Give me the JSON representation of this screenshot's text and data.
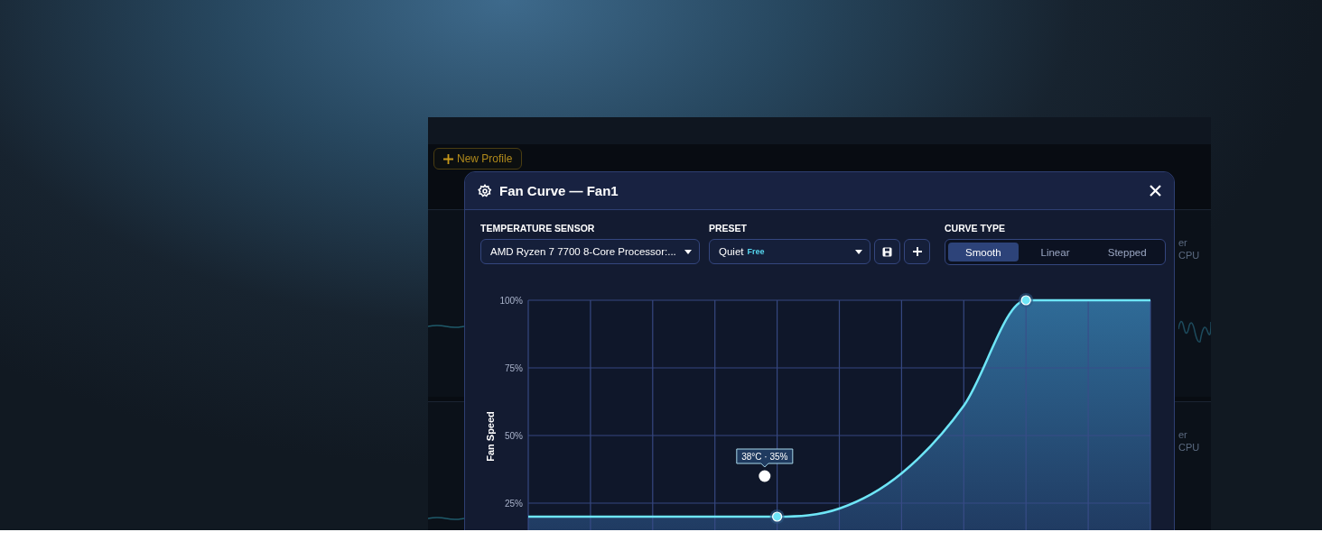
{
  "background_app": {
    "new_profile_button": "New Profile",
    "rows": [
      {
        "label": "er",
        "sublabel": "CPU",
        "wave": true
      },
      {
        "label": "er",
        "sublabel": "CPU",
        "wave": false
      }
    ]
  },
  "dialog": {
    "title": "Fan Curve — Fan1",
    "sensor": {
      "label": "TEMPERATURE SENSOR",
      "value": "AMD Ryzen 7 7700 8-Core Processor:..."
    },
    "preset": {
      "label": "PRESET",
      "value": "Quiet",
      "badge": "Free"
    },
    "curve_type": {
      "label": "CURVE TYPE",
      "options": [
        {
          "label": "Smooth",
          "selected": true
        },
        {
          "label": "Linear",
          "selected": false
        },
        {
          "label": "Stepped",
          "selected": false
        }
      ]
    },
    "chart": {
      "y_axis_label": "Fan Speed",
      "y_ticks": [
        "100%",
        "75%",
        "50%",
        "25%"
      ],
      "tooltip": "38°C · 35%"
    }
  }
}
